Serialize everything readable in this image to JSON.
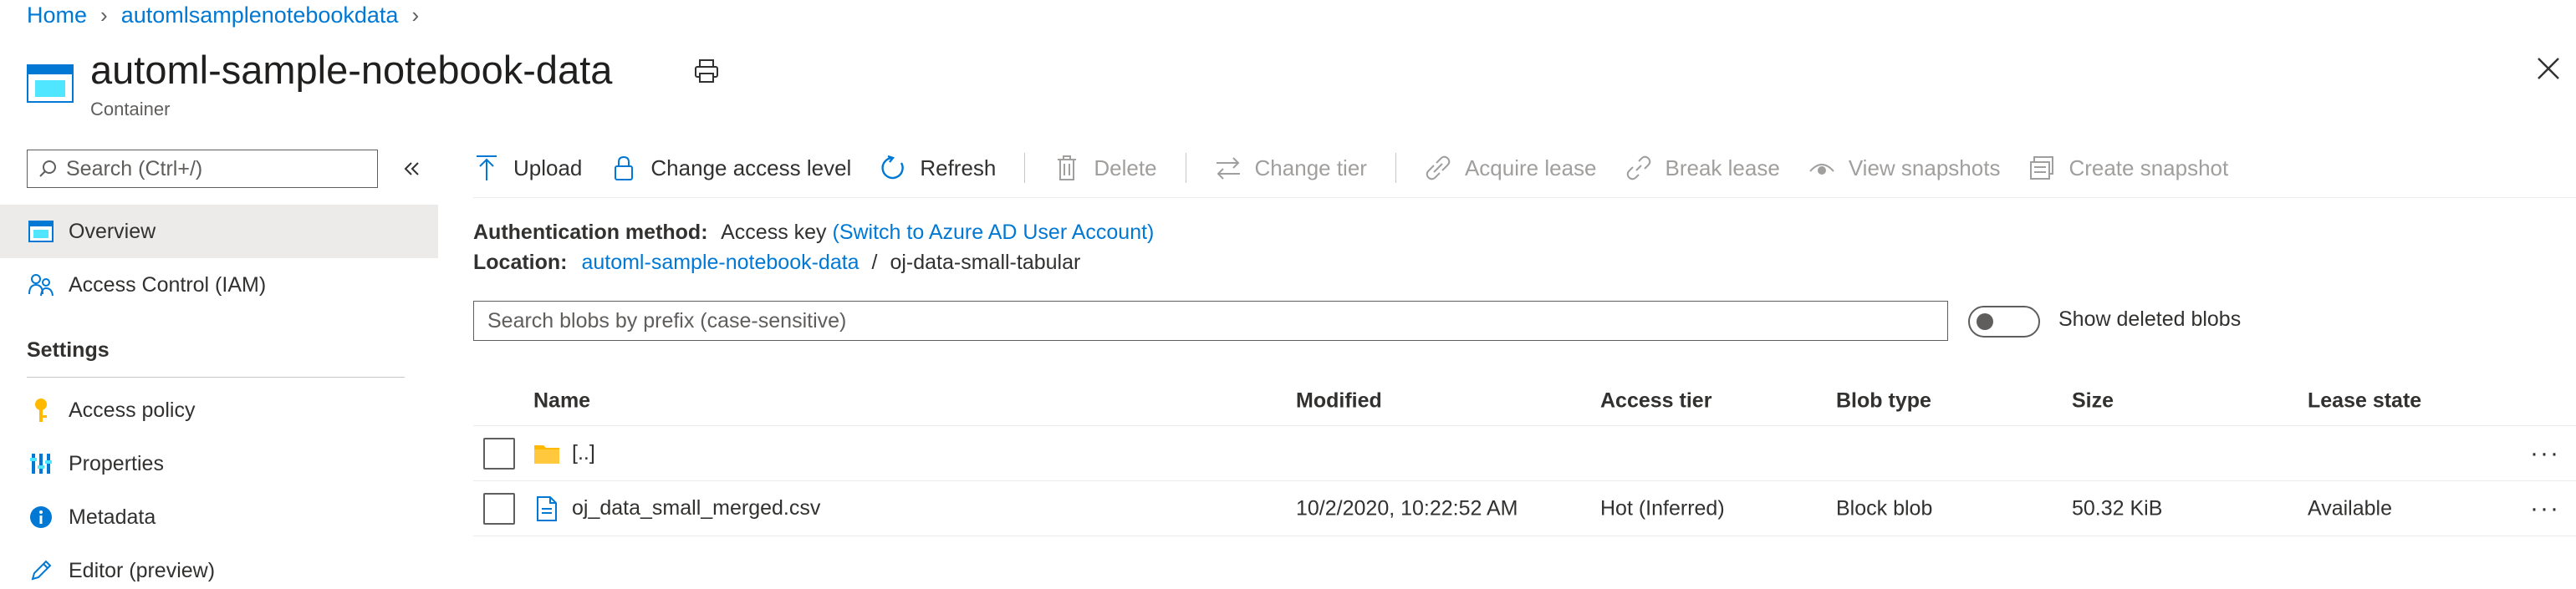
{
  "breadcrumb": [
    {
      "label": "Home"
    },
    {
      "label": "automlsamplenotebookdata"
    }
  ],
  "header": {
    "title": "automl-sample-notebook-data",
    "subtitle": "Container"
  },
  "sidebar": {
    "search_placeholder": "Search (Ctrl+/)",
    "items": [
      {
        "label": "Overview",
        "icon": "overview-icon",
        "selected": true
      },
      {
        "label": "Access Control (IAM)",
        "icon": "people-icon"
      }
    ],
    "settings_title": "Settings",
    "settings_items": [
      {
        "label": "Access policy",
        "icon": "key-icon"
      },
      {
        "label": "Properties",
        "icon": "properties-icon"
      },
      {
        "label": "Metadata",
        "icon": "info-icon"
      },
      {
        "label": "Editor (preview)",
        "icon": "pencil-icon"
      }
    ]
  },
  "toolbar": {
    "upload": "Upload",
    "change_access": "Change access level",
    "refresh": "Refresh",
    "delete": "Delete",
    "change_tier": "Change tier",
    "acquire_lease": "Acquire lease",
    "break_lease": "Break lease",
    "view_snapshots": "View snapshots",
    "create_snapshot": "Create snapshot"
  },
  "info": {
    "auth_label": "Authentication method:",
    "auth_value": "Access key",
    "auth_link": "(Switch to Azure AD User Account)",
    "location_label": "Location:",
    "location_link": "automl-sample-notebook-data",
    "location_sep": "/",
    "location_path": "oj-data-small-tabular"
  },
  "blob_search": {
    "placeholder": "Search blobs by prefix (case-sensitive)",
    "show_deleted_label": "Show deleted blobs",
    "show_deleted_on": false
  },
  "table": {
    "columns": [
      "Name",
      "Modified",
      "Access tier",
      "Blob type",
      "Size",
      "Lease state"
    ],
    "rows": [
      {
        "name": "[..]",
        "icon": "folder-icon",
        "modified": "",
        "tier": "",
        "type": "",
        "size": "",
        "lease": "",
        "more": "···"
      },
      {
        "name": "oj_data_small_merged.csv",
        "icon": "file-icon",
        "modified": "10/2/2020, 10:22:52 AM",
        "tier": "Hot (Inferred)",
        "type": "Block blob",
        "size": "50.32 KiB",
        "lease": "Available",
        "more": "···"
      }
    ]
  },
  "colors": {
    "accent": "#0078d4",
    "disabled": "#a19f9d",
    "selected_bg": "#edebe9",
    "folder": "#ffb900"
  }
}
